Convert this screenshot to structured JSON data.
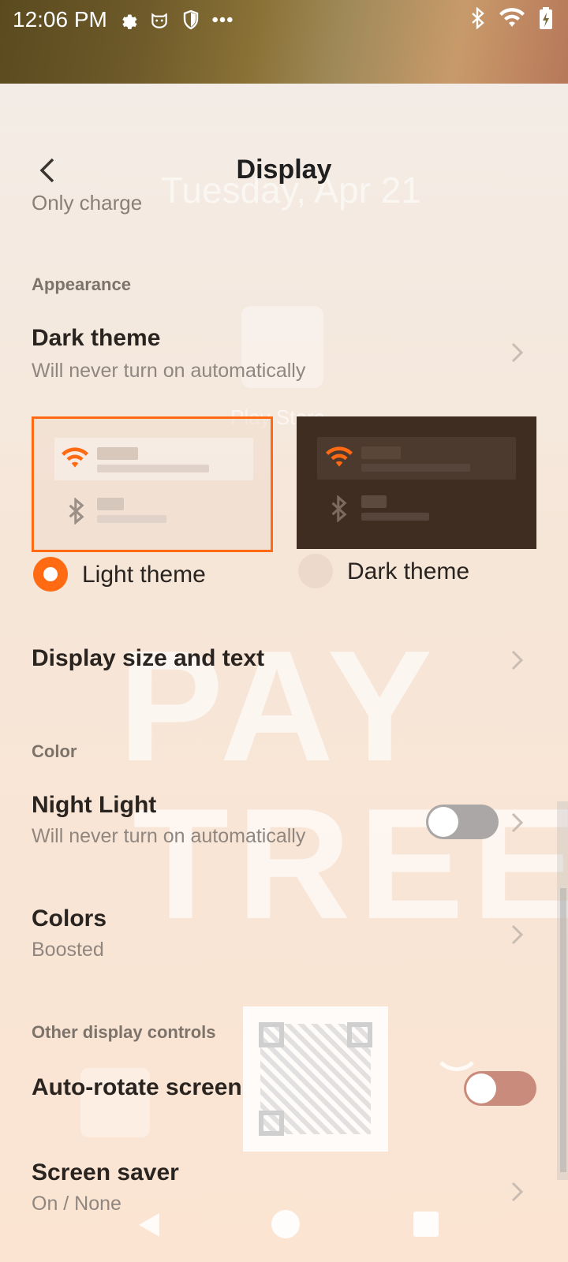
{
  "status_bar": {
    "time": "12:06 PM",
    "left_icons": [
      "gear-icon",
      "cat-face-icon",
      "shield-icon",
      "more-dots-icon"
    ],
    "right_icons": [
      "bluetooth-icon",
      "wifi-icon",
      "battery-icon"
    ]
  },
  "header": {
    "title": "Display"
  },
  "cut_off_text": "Only charge",
  "appearance": {
    "section_label": "Appearance",
    "dark_theme": {
      "title": "Dark theme",
      "subtitle": "Will never turn on automatically"
    },
    "theme_options": [
      {
        "label": "Light theme",
        "selected": true
      },
      {
        "label": "Dark theme",
        "selected": false
      }
    ]
  },
  "display_size": {
    "title": "Display size and text"
  },
  "color": {
    "section_label": "Color",
    "night_light": {
      "title": "Night Light",
      "subtitle": "Will never turn on automatically",
      "enabled": false
    },
    "colors": {
      "title": "Colors",
      "subtitle": "Boosted"
    }
  },
  "other": {
    "section_label": "Other display controls",
    "auto_rotate": {
      "title": "Auto-rotate screen",
      "enabled": false
    },
    "screen_saver": {
      "title": "Screen saver",
      "subtitle": "On / None"
    }
  },
  "background": {
    "date": "Tuesday, Apr 21",
    "app_label": "Play Store",
    "banner_line1": "PAY",
    "banner_line2": "TREE"
  },
  "colors": {
    "accent": "#ff6a13",
    "dark_card": "#3f2d22",
    "toggle_off": "#aaa7a6",
    "toggle_off_accent": "#c98c7c"
  }
}
